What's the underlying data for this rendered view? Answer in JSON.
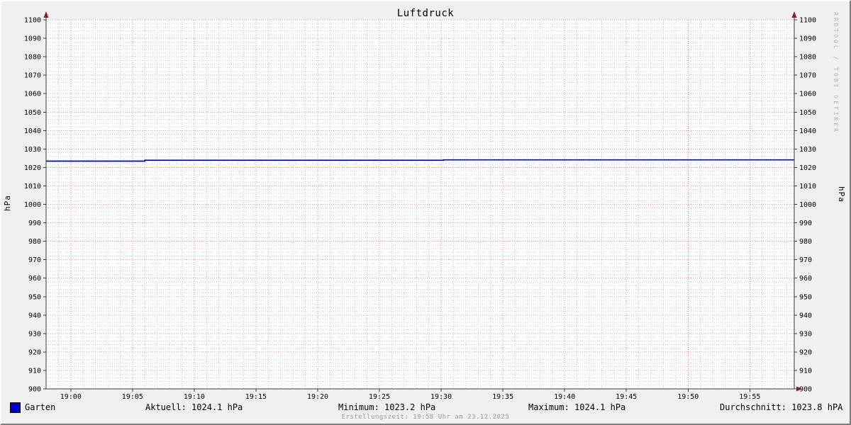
{
  "title": "Luftdruck",
  "watermark": "RRDTOOL / TOBI OETIKER",
  "footer": "Erstellungszeit: 19:58 Uhr am 23.12.2025",
  "y_axis_unit": "hPa",
  "legend": {
    "series_label": "Garten",
    "swatch_color": "#0000c6"
  },
  "stats_row": {
    "aktuell": "Aktuell: 1024.1 hPa",
    "minimum": "Minimum: 1023.2 hPa",
    "maximum": "Maximum: 1024.1 hPa",
    "durchschnitt": "Durchschnitt: 1023.8 hPA"
  },
  "colors": {
    "background": "#f0f0f0",
    "plot_background": "#ffffff",
    "grid_major": "#f09898",
    "grid_minor": "#d2d2d2",
    "axis": "#3a3a3a",
    "arrow": "#8b2020",
    "line": "#0000c6",
    "text": "#000000"
  },
  "chart_data": {
    "type": "line",
    "title": "Luftdruck",
    "xlabel": "",
    "ylabel": "hPa",
    "ylim": [
      900,
      1100
    ],
    "y_major_step": 10,
    "y_minor_step": 2,
    "grid": "dotted, red major / gray minor",
    "legend_position": "bottom-left",
    "x_tick_labels": [
      "19:00",
      "19:05",
      "19:10",
      "19:15",
      "19:20",
      "19:25",
      "19:30",
      "19:35",
      "19:40",
      "19:45",
      "19:50",
      "19:55"
    ],
    "x_tick_minutes": [
      0,
      5,
      10,
      15,
      20,
      25,
      30,
      35,
      40,
      45,
      50,
      55
    ],
    "xlim_minutes": [
      -2,
      58.6
    ],
    "x_minor_step_minutes": 1,
    "series": [
      {
        "name": "Garten",
        "color": "#0000c6",
        "unit": "hPa",
        "points_min_hpa": [
          [
            -2,
            1023.4
          ],
          [
            6,
            1023.4
          ],
          [
            6,
            1023.9
          ],
          [
            30.2,
            1023.9
          ],
          [
            30.2,
            1024.1
          ],
          [
            58.6,
            1024.1
          ]
        ]
      }
    ],
    "stats": {
      "aktuell": 1024.1,
      "minimum": 1023.2,
      "maximum": 1024.1,
      "durchschnitt": 1023.8
    }
  }
}
